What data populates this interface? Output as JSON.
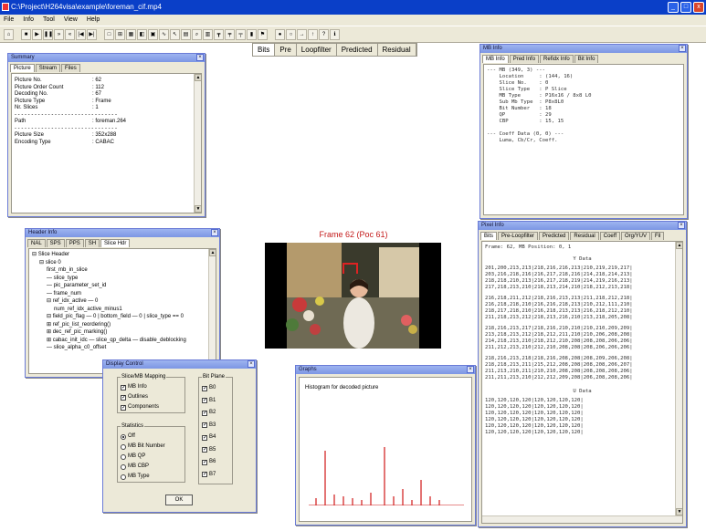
{
  "app": {
    "title": "C:\\Project\\H264visa\\example\\foreman_cif.mp4"
  },
  "window_buttons": {
    "min": "_",
    "max": "□",
    "close": "x"
  },
  "menu": [
    "File",
    "Info",
    "Tool",
    "View",
    "Help"
  ],
  "toolbar_icons": [
    "open-icon",
    "stop-icon",
    "play-icon",
    "pause-icon",
    "next-icon",
    "prev-icon",
    "first-icon",
    "last-icon",
    "frame-icon",
    "mb-icon",
    "grid-icon",
    "view-icon",
    "save-icon",
    "curve-icon",
    "pointer-icon",
    "color-icon",
    "binoculars-icon",
    "table-icon",
    "split-icon",
    "split2-icon",
    "split3-icon",
    "chart-icon",
    "flag-icon",
    "circle-icon",
    "circle2-icon",
    "arrow-icon",
    "up-icon",
    "help-icon",
    "info-icon"
  ],
  "view_tabs": [
    "Bits",
    "Pre",
    "Loopfilter",
    "Predicted",
    "Residual"
  ],
  "summary": {
    "title": "Summary",
    "tabs": [
      "Picture",
      "Stream",
      "Files"
    ],
    "rows": [
      {
        "k": "Picture No.",
        "v": ": 62"
      },
      {
        "k": "Picture Order Count",
        "v": ": 112"
      },
      {
        "k": "Decoding No.",
        "v": ": 67"
      },
      {
        "k": "Picture Type",
        "v": ": Frame"
      },
      {
        "k": "Nr. Slices",
        "v": ": 1"
      },
      {
        "k": "Path",
        "v": ": foreman.264"
      },
      {
        "k": "Picture Size",
        "v": ": 352x288"
      },
      {
        "k": "Encoding Type",
        "v": ": CABAC"
      }
    ]
  },
  "mbinfo": {
    "title": "MB Info",
    "tabs": [
      "MB Info",
      "Pred Info",
      "Refidx Info",
      "Bit Info"
    ],
    "lines": "--- MB (349, 3) ---\n    Location     : (144, 16)\n    Slice No.    : 0\n    Slice Type   : P Slice\n    MB Type      : P16x16 / 8x8 L0\n    Sub Mb Type  : P8x8L0\n    Bit Number   : 18\n    QP           : 29\n    CBP          : 15, 15\n\n--- Coeff Data (0, 0) ---\n    Luma, Cb/Cr, Coeff."
  },
  "header": {
    "title": "Header Info",
    "tabs": [
      "NAL",
      "SPS",
      "PPS",
      "SH",
      "Slice Hdr"
    ],
    "tree": [
      {
        "t": "Slice Header",
        "d": 0,
        "s": "⊟"
      },
      {
        "t": "slice 0",
        "d": 1,
        "s": "⊟"
      },
      {
        "t": "first_mb_in_slice",
        "d": 2,
        "s": ""
      },
      {
        "t": "slice_type",
        "d": 2,
        "s": "—"
      },
      {
        "t": "pic_parameter_set_id",
        "d": 2,
        "s": "—"
      },
      {
        "t": "frame_num",
        "d": 2,
        "s": "—"
      },
      {
        "t": "ref_idx_active — 0",
        "d": 2,
        "s": "⊟"
      },
      {
        "t": "num_ref_idx_active_minus1",
        "d": 3,
        "s": ""
      },
      {
        "t": "field_pic_flag — 0 | bottom_field — 0 | slice_type == 0",
        "d": 2,
        "s": "⊟"
      },
      {
        "t": "ref_pic_list_reordering()",
        "d": 2,
        "s": "⊞"
      },
      {
        "t": "dec_ref_pic_marking()",
        "d": 2,
        "s": "⊞"
      },
      {
        "t": "cabac_init_idc — slice_qp_delta — disable_deblocking",
        "d": 2,
        "s": "⊞"
      },
      {
        "t": "slice_alpha_c0_offset",
        "d": 2,
        "s": "—"
      }
    ]
  },
  "frame": {
    "label": "Frame 62 (Poc 61)"
  },
  "display": {
    "title": "Display Control",
    "left_group": "Slice/MB Mapping",
    "left_items": [
      {
        "t": "MB Info",
        "c": true
      },
      {
        "t": "Outlines",
        "c": true
      },
      {
        "t": "Components",
        "c": true
      }
    ],
    "stat_group": "Statistics",
    "stat_items": [
      {
        "t": "Off",
        "on": true
      },
      {
        "t": "MB Bit Number",
        "on": false
      },
      {
        "t": "MB QP",
        "on": false
      },
      {
        "t": "MB CBP",
        "on": false
      },
      {
        "t": "MB Type",
        "on": false
      }
    ],
    "bit_group": "Bit Plane",
    "bit_items": [
      "B0",
      "B1",
      "B2",
      "B3",
      "B4",
      "B5",
      "B6",
      "B7"
    ],
    "ok": "OK"
  },
  "graphs": {
    "title": "Graphs",
    "caption": "Histogram for decoded picture",
    "bars": [
      4,
      30,
      6,
      5,
      4,
      3,
      7,
      32,
      5,
      9,
      3,
      14,
      5,
      3
    ],
    "ymax": 50
  },
  "pixel": {
    "title": "Pixel Info",
    "tabs": [
      "Bits",
      "Pre-Loopfilter",
      "Predicted",
      "Residual",
      "Coeff",
      "Org/YUV",
      "Fil"
    ],
    "header_line": "Frame: 62, MB Position: 0, 1",
    "y_label": "Y Data",
    "y_block1": "201,200,213,213|218,216,216,213|210,219,219,217|\n203,216,218,216|216,217,218,216|214,218,214,213|\n218,218,210,213|216,217,218,219|214,219,216,213|\n217,218,213,210|218,213,214,210|218,212,213,218|",
    "y_block2": "216,218,211,212|218,216,213,213|211,218,212,218|\n216,218,218,210|216,216,218,213|210,212,111,210|\n218,217,218,210|216,218,213,213|216,218,212,210|\n211,218,213,212|218,213,216,210|213,218,205,208|",
    "y_block3": "218,216,213,217|218,216,210,210|210,210,209,209|\n213,218,213,212|218,212,211,210|210,206,208,208|\n214,218,213,210|218,212,210,208|208,208,206,206|\n211,212,213,210|212,210,208,208|208,206,206,206|",
    "y_block4": "218,216,213,218|218,216,208,208|208,209,206,208|\n218,218,213,211|215,212,208,208|208,208,206,207|\n211,213,210,211|210,210,208,208|208,208,208,206|\n211,211,213,210|212,212,209,208|206,208,208,206|",
    "u_label": "U Data",
    "u_block": "120,120,120,120|120,120,120,120|\n120,120,120,120|120,120,120,120|\n120,120,120,120|120,120,120,120|\n120,120,120,120|120,120,120,120|\n120,120,120,120|120,120,120,120|\n120,120,120,120|120,120,120,120|"
  }
}
